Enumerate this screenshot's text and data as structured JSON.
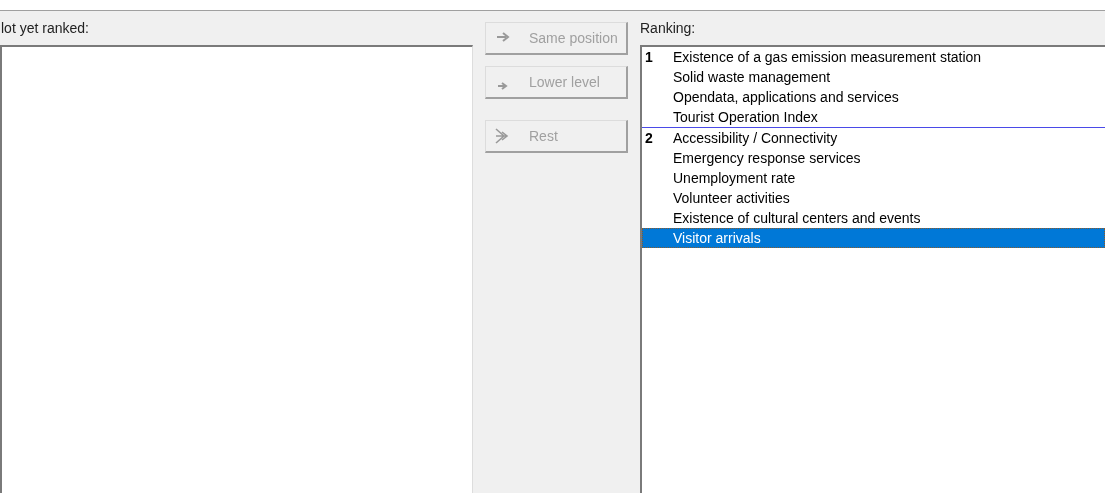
{
  "not_ranked_panel": {
    "label": "lot yet ranked:"
  },
  "buttons": [
    {
      "label": "Same position",
      "disabled": true,
      "kind": "same"
    },
    {
      "label": "Lower level",
      "disabled": true,
      "kind": "lower"
    },
    {
      "label": "Rest",
      "disabled": true,
      "kind": "rest"
    }
  ],
  "ranking_panel": {
    "label": "Ranking:",
    "groups": [
      {
        "rank": "1",
        "items": [
          {
            "label": "Existence of a gas emission measurement station",
            "selected": false
          },
          {
            "label": "Solid waste management",
            "selected": false
          },
          {
            "label": "Opendata, applications and services",
            "selected": false
          },
          {
            "label": "Tourist Operation Index",
            "selected": false
          }
        ]
      },
      {
        "rank": "2",
        "items": [
          {
            "label": "Accessibility / Connectivity",
            "selected": false
          },
          {
            "label": "Emergency response services",
            "selected": false
          },
          {
            "label": "Unemployment rate",
            "selected": false
          },
          {
            "label": "Volunteer activities",
            "selected": false
          },
          {
            "label": "Existence of cultural centers and events",
            "selected": false
          },
          {
            "label": "Visitor arrivals",
            "selected": true
          }
        ]
      }
    ]
  }
}
